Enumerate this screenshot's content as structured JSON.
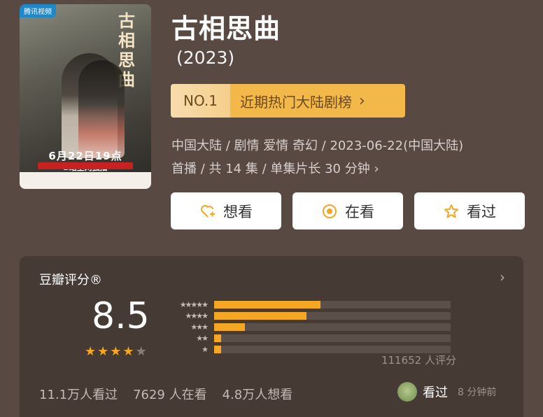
{
  "poster": {
    "tag": "腾讯视频",
    "calligraphy": "古相思曲",
    "release": "6月22日19点",
    "platform": "B站全网独播"
  },
  "title": "古相思曲",
  "year": "(2023)",
  "rank": {
    "no": "NO.1",
    "list": "近期热门大陆剧榜"
  },
  "meta": {
    "line1": "中国大陆 / 剧情 爱情 奇幻 / 2023-06-22(中国大陆)",
    "line2": "首播 / 共 14 集 / 单集片长 30 分钟"
  },
  "actions": [
    {
      "label": "想看",
      "icon": "heart-plus-icon"
    },
    {
      "label": "在看",
      "icon": "target-icon"
    },
    {
      "label": "看过",
      "icon": "star-icon"
    }
  ],
  "rating": {
    "header": "豆瓣评分®",
    "score": "8.5",
    "stars_filled": 4,
    "stars_total": 5,
    "distribution": [
      {
        "label": "★★★★★",
        "pct": 45
      },
      {
        "label": "★★★★",
        "pct": 39
      },
      {
        "label": "★★★",
        "pct": 13
      },
      {
        "label": "★★",
        "pct": 3
      },
      {
        "label": "★",
        "pct": 3
      }
    ],
    "count": "111652 人评分"
  },
  "stats": [
    "11.1万人看过",
    "7629 人在看",
    "4.8万人想看"
  ],
  "friend": {
    "action": "看过",
    "time": "8 分钟前"
  },
  "colors": {
    "background": "#584a43",
    "card": "#463a34",
    "accent": "#f5a623"
  }
}
